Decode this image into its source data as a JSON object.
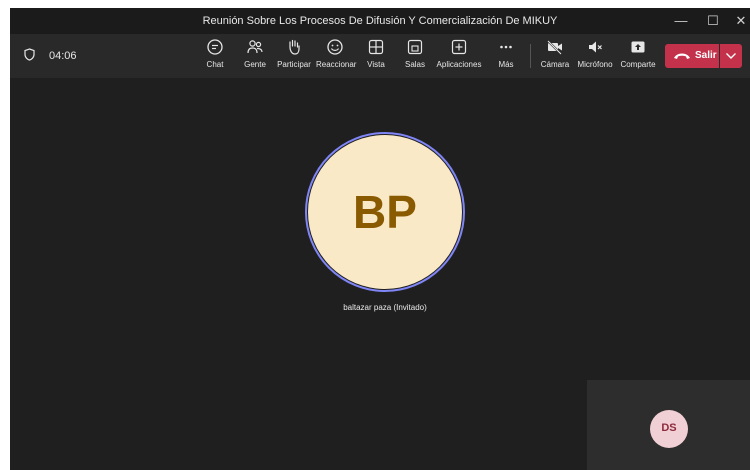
{
  "window": {
    "title": "Reunión Sobre Los Procesos De Difusión Y Comercialización De MIKUY",
    "controls": {
      "minimize": "—",
      "maximize": "☐",
      "close": "✕"
    }
  },
  "toolbar": {
    "timer": "04:06",
    "buttons": [
      {
        "label": "Chat",
        "icon": "chat-icon"
      },
      {
        "label": "Gente",
        "icon": "people-icon"
      },
      {
        "label": "Participar",
        "icon": "raise-hand-icon"
      },
      {
        "label": "Reaccionar",
        "icon": "smiley-icon"
      },
      {
        "label": "Vista",
        "icon": "grid-icon"
      },
      {
        "label": "Salas",
        "icon": "rooms-icon"
      },
      {
        "label": "Aplicaciones",
        "icon": "plus-square-icon"
      },
      {
        "label": "Más",
        "icon": "ellipsis-icon"
      },
      {
        "label": "Cámara",
        "icon": "camera-off-icon"
      },
      {
        "label": "Micrófono",
        "icon": "mic-muted-icon"
      },
      {
        "label": "Comparte",
        "icon": "share-icon"
      }
    ],
    "leave_label": "Salir"
  },
  "stage": {
    "participant": {
      "initials": "BP",
      "name": "baltazar paza (Invitado)"
    },
    "self_view": {
      "initials": "DS"
    }
  },
  "colors": {
    "leave_red": "#c4314b",
    "avatar_bg": "#f9e9c6",
    "avatar_text": "#8a5a00",
    "ring": "#7f85f5",
    "self_avatar_bg": "#f1d0d5"
  }
}
